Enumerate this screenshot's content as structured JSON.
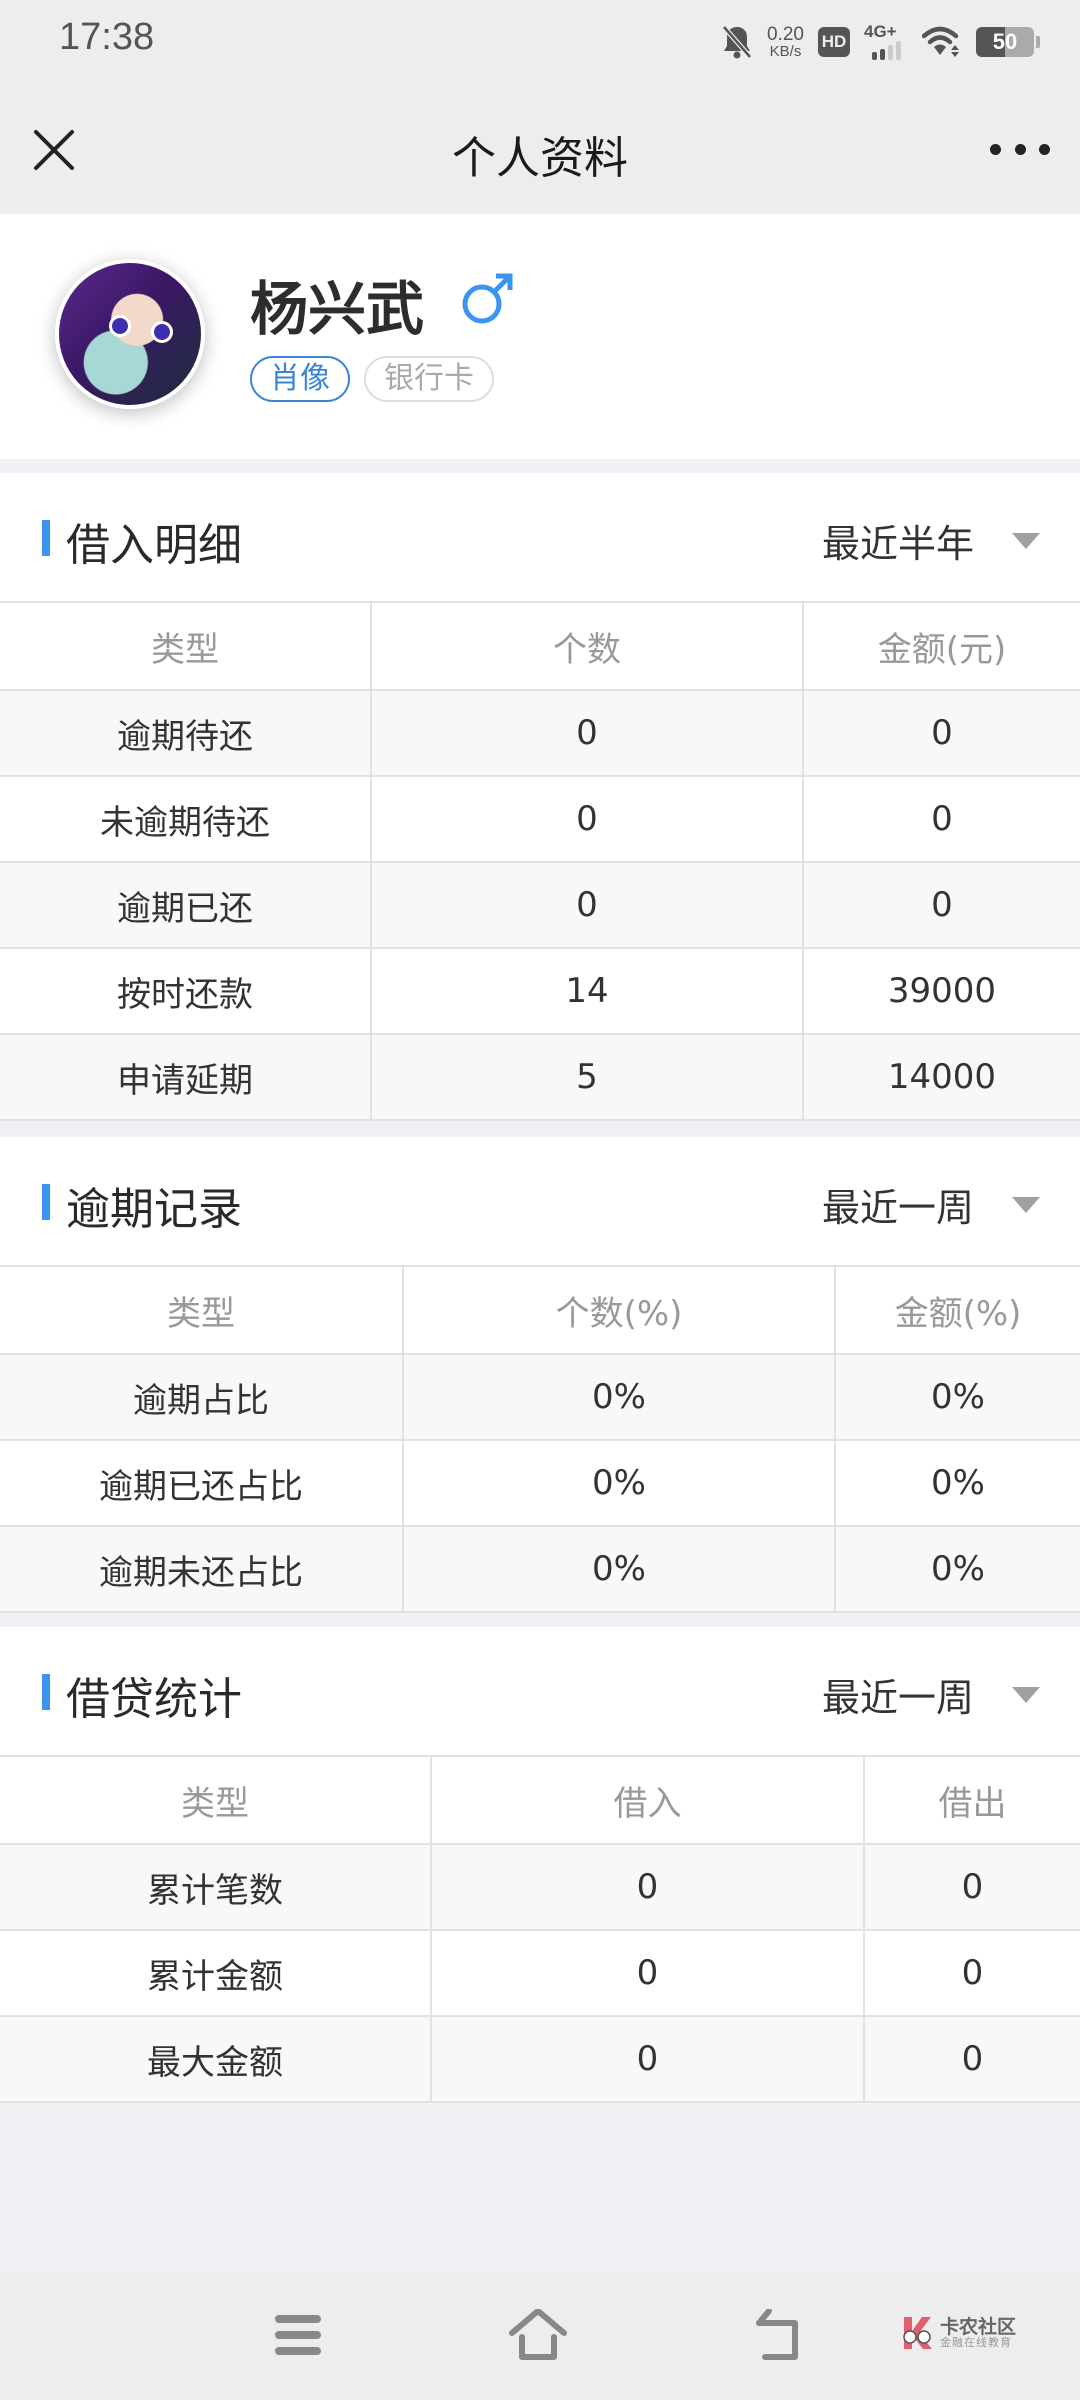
{
  "status_bar": {
    "time": "17:38",
    "net_speed_value": "0.20",
    "net_speed_unit": "KB/s",
    "hd_label": "HD",
    "network_label": "4G+",
    "battery_percent": 50,
    "battery_label": "50"
  },
  "nav": {
    "title": "个人资料",
    "close_icon": "close-icon",
    "more_icon": "more-dots-icon"
  },
  "profile": {
    "name": "杨兴武",
    "gender": "male",
    "gender_symbol": "♂",
    "gender_color": "#3a95f0",
    "tags": [
      {
        "label": "肖像",
        "active": true
      },
      {
        "label": "银行卡",
        "active": false
      }
    ]
  },
  "sections": [
    {
      "title": "借入明细",
      "filter": "最近半年",
      "columns": [
        "类型",
        "个数",
        "金额(元)"
      ],
      "rows": [
        [
          "逾期待还",
          "0",
          "0"
        ],
        [
          "未逾期待还",
          "0",
          "0"
        ],
        [
          "逾期已还",
          "0",
          "0"
        ],
        [
          "按时还款",
          "14",
          "39000"
        ],
        [
          "申请延期",
          "5",
          "14000"
        ]
      ]
    },
    {
      "title": "逾期记录",
      "filter": "最近一周",
      "columns": [
        "类型",
        "个数(%)",
        "金额(%)"
      ],
      "rows": [
        [
          "逾期占比",
          "0%",
          "0%"
        ],
        [
          "逾期已还占比",
          "0%",
          "0%"
        ],
        [
          "逾期未还占比",
          "0%",
          "0%"
        ]
      ]
    },
    {
      "title": "借贷统计",
      "filter": "最近一周",
      "columns": [
        "类型",
        "借入",
        "借出"
      ],
      "rows": [
        [
          "累计笔数",
          "0",
          "0"
        ],
        [
          "累计金额",
          "0",
          "0"
        ],
        [
          "最大金额",
          "0",
          "0"
        ]
      ]
    }
  ],
  "watermark": {
    "title": "卡农社区",
    "subtitle": "金融在线教育"
  },
  "colors": {
    "accent": "#3a95f0",
    "tag_active": "#3a86d6",
    "page_bg": "#f0f1f5"
  }
}
